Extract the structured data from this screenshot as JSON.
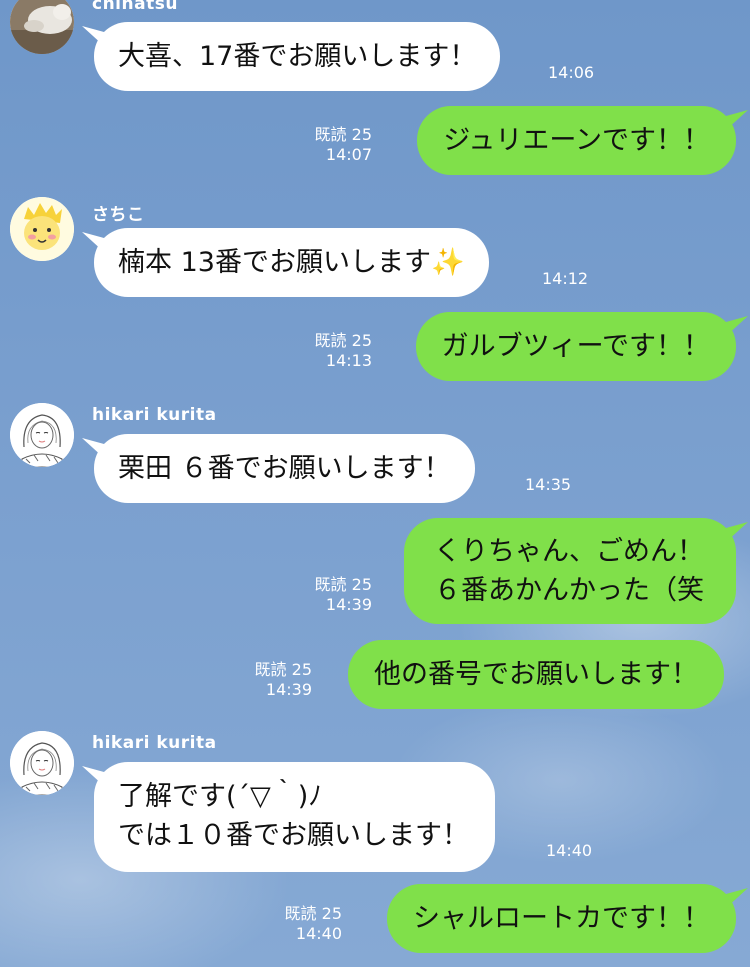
{
  "colors": {
    "incoming_bubble": "#ffffff",
    "outgoing_bubble": "#80e04a",
    "background": "#7ba0cf",
    "meta_text": "#ffffff"
  },
  "messages": [
    {
      "sender": "chinatsu",
      "text": "大喜、17番でお願いします！",
      "time": "14:06",
      "avatar": "cat-photo-avatar"
    },
    {
      "text": "ジュリエーンです！！",
      "read": "既読 25",
      "time": "14:07"
    },
    {
      "sender": "さちこ",
      "text": "楠本 13番でお願いします✨",
      "time": "14:12",
      "avatar": "yellow-character-avatar"
    },
    {
      "text": "ガルブツィーです！！",
      "read": "既読 25",
      "time": "14:13"
    },
    {
      "sender": "hikari kurita",
      "text": "栗田 ６番でお願いします！",
      "time": "14:35",
      "avatar": "sketch-girl-avatar"
    },
    {
      "lines": [
        "くりちゃん、ごめん！",
        "６番あかんかった（笑"
      ],
      "read": "既読 25",
      "time": "14:39"
    },
    {
      "text": "他の番号でお願いします！",
      "read": "既読 25",
      "time": "14:39"
    },
    {
      "sender": "hikari kurita",
      "lines": [
        "了解です(´▽｀)ﾉ",
        "では１０番でお願いします！"
      ],
      "time": "14:40",
      "avatar": "sketch-girl-avatar"
    },
    {
      "text": "シャルロートカです！！",
      "read": "既読 25",
      "time": "14:40"
    }
  ]
}
